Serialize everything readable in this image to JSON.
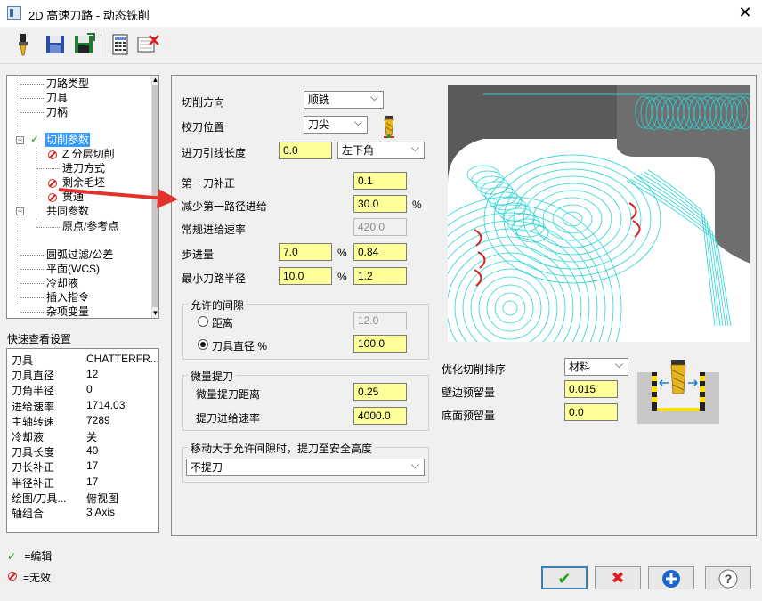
{
  "window": {
    "title": "2D 高速刀路 - 动态铣削",
    "close_glyph": "✕"
  },
  "toolbar": {
    "icons": [
      "tool-icon",
      "save-icon",
      "save-as-icon",
      "calculator-icon",
      "delete-icon"
    ]
  },
  "tree": {
    "items": [
      "刀路类型",
      "刀具",
      "刀柄",
      "切削参数",
      "Z 分层切削",
      "进刀方式",
      "剩余毛坯",
      "贯通",
      "共同参数",
      "原点/参考点",
      "圆弧过滤/公差",
      "平面(WCS)",
      "冷却液",
      "插入指令",
      "杂项变量"
    ]
  },
  "quick_view": {
    "title": "快速查看设置",
    "rows": [
      {
        "k": "刀具",
        "v": "CHATTERFR..."
      },
      {
        "k": "刀具直径",
        "v": "12"
      },
      {
        "k": "刀角半径",
        "v": "0"
      },
      {
        "k": "进给速率",
        "v": "1714.03"
      },
      {
        "k": "主轴转速",
        "v": "7289"
      },
      {
        "k": "冷却液",
        "v": "关"
      },
      {
        "k": "刀具长度",
        "v": "40"
      },
      {
        "k": "刀长补正",
        "v": "17"
      },
      {
        "k": "半径补正",
        "v": "17"
      },
      {
        "k": "绘图/刀具...",
        "v": "俯视图"
      },
      {
        "k": "轴组合",
        "v": "3 Axis"
      }
    ]
  },
  "legend": {
    "edit_label": "=编辑",
    "invalid_label": "=无效"
  },
  "params": {
    "cut_direction_label": "切削方向",
    "cut_direction_value": "顺铣",
    "compensation_label": "校刀位置",
    "compensation_value": "刀尖",
    "lead_in_label": "进刀引线长度",
    "lead_in_value": "0.0",
    "lead_in_position": "左下角",
    "first_offset_label": "第一刀补正",
    "first_offset_value": "0.1",
    "reduce_first_label": "减少第一路径进给",
    "reduce_first_value": "30.0",
    "reduce_first_unit": "%",
    "normal_feed_label": "常规进给速率",
    "normal_feed_value": "420.0",
    "stepover_label": "步进量",
    "stepover_pct": "7.0",
    "stepover_pct_unit": "%",
    "stepover_abs": "0.84",
    "min_radius_label": "最小刀路半径",
    "min_radius_pct": "10.0",
    "min_radius_pct_unit": "%",
    "min_radius_abs": "1.2",
    "gap_group_title": "允许的间隙",
    "gap_distance_label": "距离",
    "gap_distance_value": "12.0",
    "gap_tooldia_label": "刀具直径 %",
    "gap_tooldia_value": "100.0",
    "microlift_group_title": "微量提刀",
    "microlift_dist_label": "微量提刀距离",
    "microlift_dist_value": "0.25",
    "microlift_feed_label": "提刀进给速率",
    "microlift_feed_value": "4000.0",
    "retract_group_title": "移动大于允许间隙时，提刀至安全高度",
    "retract_value": "不提刀",
    "optimize_label": "优化切削排序",
    "optimize_value": "材料",
    "wall_stock_label": "壁边预留量",
    "wall_stock_value": "0.015",
    "floor_stock_label": "底面预留量",
    "floor_stock_value": "0.0"
  },
  "colors": {
    "field_yellow": "#ffff99",
    "toolpath": "#27d4d4",
    "arrow_red": "#e2322b",
    "selected_blue": "#3399ff"
  }
}
